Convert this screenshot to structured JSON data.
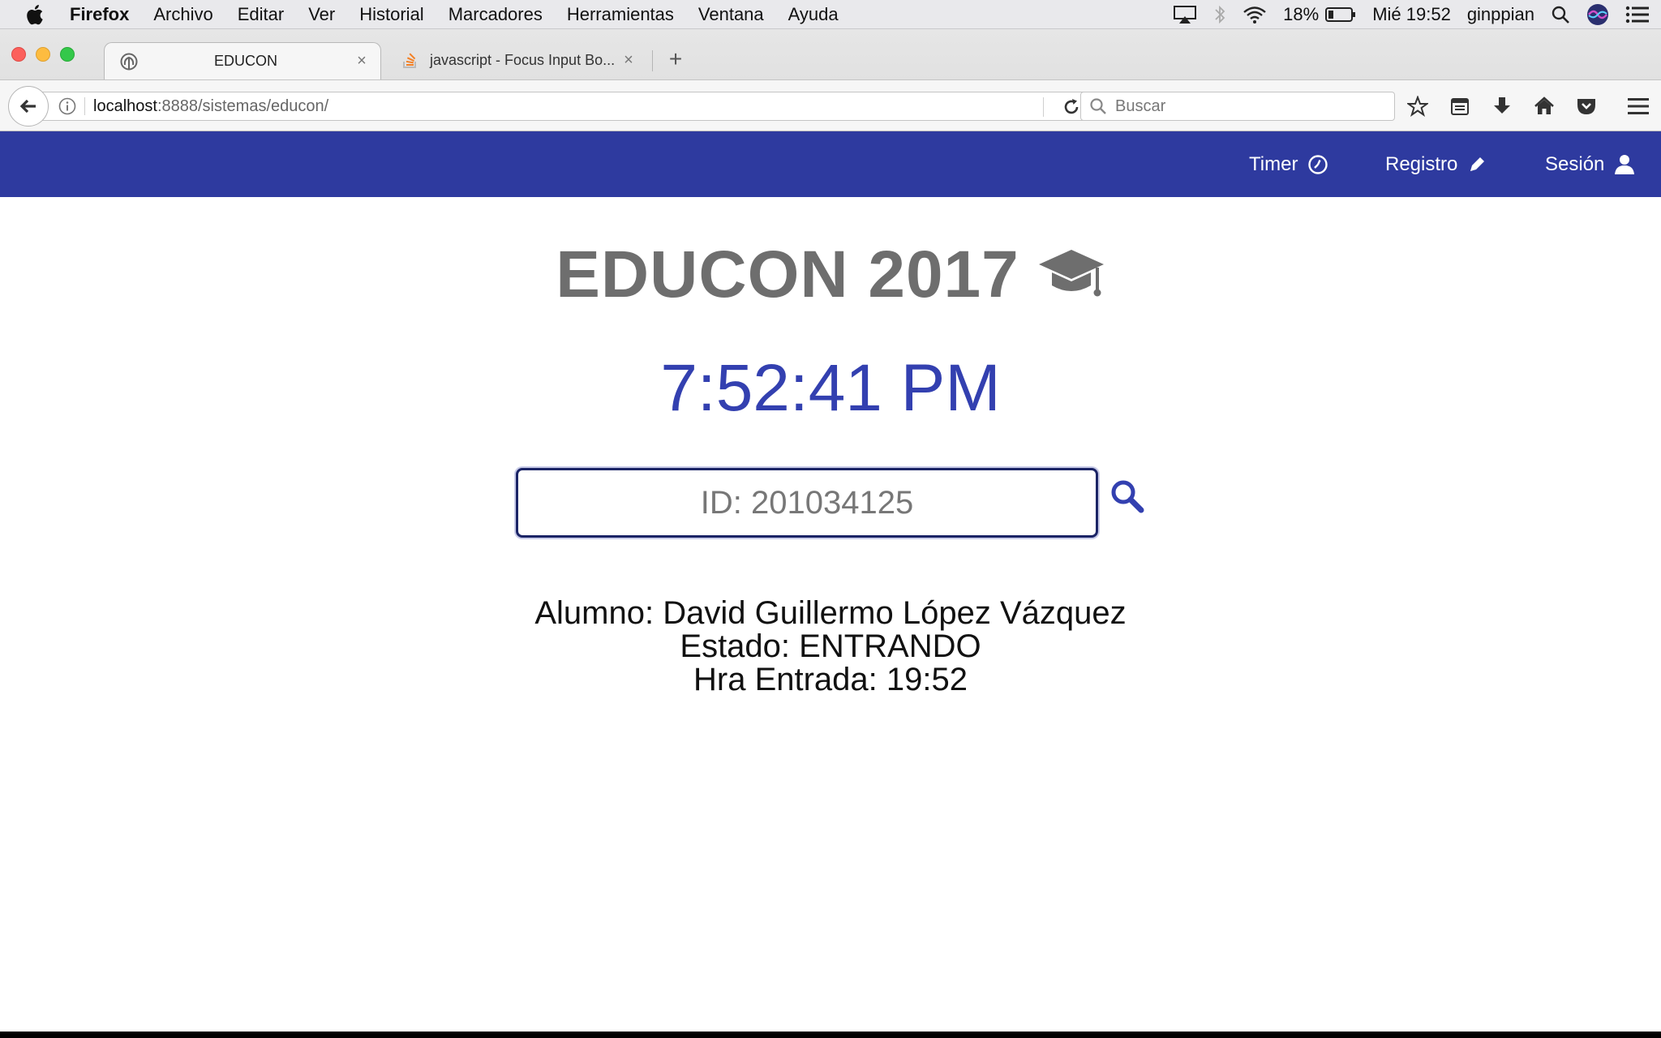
{
  "menubar": {
    "app": "Firefox",
    "items": [
      "Archivo",
      "Editar",
      "Ver",
      "Historial",
      "Marcadores",
      "Herramientas",
      "Ventana",
      "Ayuda"
    ],
    "battery": "18%",
    "datetime": "Mié 19:52",
    "user": "ginppian"
  },
  "browser": {
    "tabs": [
      {
        "title": "EDUCON"
      },
      {
        "title": "javascript - Focus Input Bo..."
      }
    ],
    "url_host": "localhost",
    "url_path": ":8888/sistemas/educon/",
    "search_placeholder": "Buscar"
  },
  "appnav": {
    "timer": "Timer",
    "registro": "Registro",
    "sesion": "Sesión"
  },
  "main": {
    "title": "EDUCON 2017",
    "clock": "7:52:41 PM",
    "id_placeholder": "ID: 201034125",
    "alumno": "Alumno: David Guillermo López Vázquez",
    "estado": "Estado: ENTRANDO",
    "hora": "Hra Entrada: 19:52"
  },
  "colors": {
    "navbar": "#2e3a9f",
    "clock": "#3340b0",
    "title": "#6e6e6e"
  }
}
